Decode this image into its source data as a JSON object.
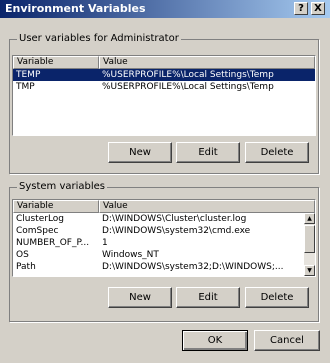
{
  "window": {
    "title": "Environment Variables",
    "help_label": "?",
    "close_label": "X"
  },
  "user_vars": {
    "label": "User variables for Administrator",
    "headers": {
      "variable": "Variable",
      "value": "Value"
    },
    "rows": [
      {
        "variable": "TEMP",
        "value": "%USERPROFILE%\\Local Settings\\Temp",
        "selected": true
      },
      {
        "variable": "TMP",
        "value": "%USERPROFILE%\\Local Settings\\Temp",
        "selected": false
      }
    ],
    "buttons": {
      "new": "New",
      "edit": "Edit",
      "delete": "Delete"
    }
  },
  "system_vars": {
    "label": "System variables",
    "headers": {
      "variable": "Variable",
      "value": "Value"
    },
    "rows": [
      {
        "variable": "ClusterLog",
        "value": "D:\\WINDOWS\\Cluster\\cluster.log"
      },
      {
        "variable": "ComSpec",
        "value": "D:\\WINDOWS\\system32\\cmd.exe"
      },
      {
        "variable": "NUMBER_OF_P...",
        "value": "1"
      },
      {
        "variable": "OS",
        "value": "Windows_NT"
      },
      {
        "variable": "Path",
        "value": "D:\\WINDOWS\\system32;D:\\WINDOWS;..."
      }
    ],
    "buttons": {
      "new": "New",
      "edit": "Edit",
      "delete": "Delete"
    }
  },
  "footer": {
    "ok": "OK",
    "cancel": "Cancel"
  },
  "colors": {
    "selection": "#0a246a",
    "face": "#d4d0c8"
  }
}
